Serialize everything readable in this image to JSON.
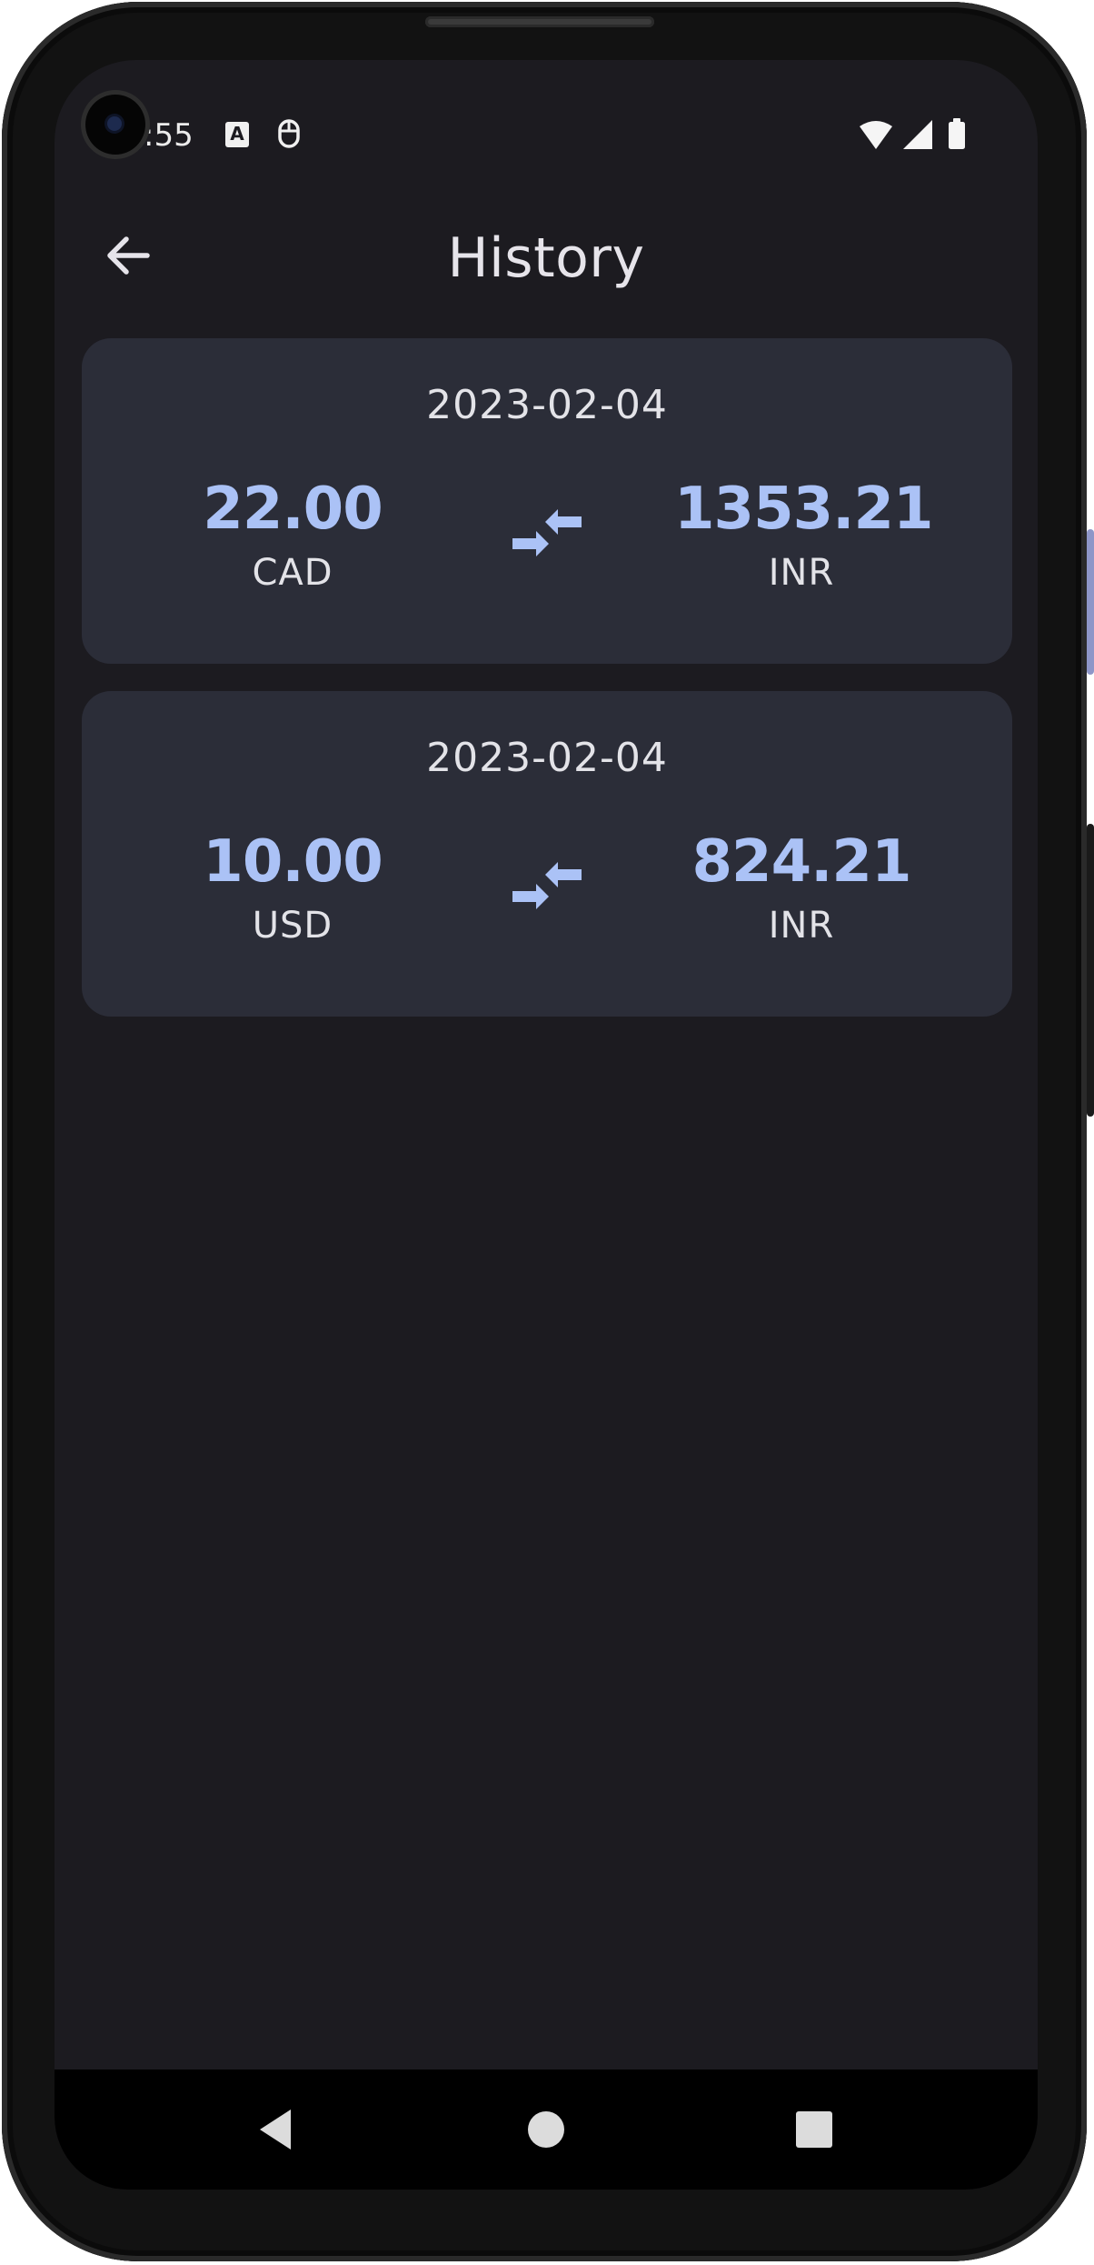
{
  "status_bar": {
    "time": ":55",
    "icons": [
      "a11y-letter-icon",
      "mouse-icon",
      "wifi-icon",
      "cellular-signal-icon",
      "battery-icon"
    ],
    "a_icon_letter": "A"
  },
  "header": {
    "title": "History",
    "back_icon": "arrow-back-icon"
  },
  "history": [
    {
      "date": "2023-02-04",
      "from_amount": "22.00",
      "from_currency": "CAD",
      "to_amount": "1353.21",
      "to_currency": "INR",
      "swap_icon": "compare-arrows-icon"
    },
    {
      "date": "2023-02-04",
      "from_amount": "10.00",
      "from_currency": "USD",
      "to_amount": "824.21",
      "to_currency": "INR",
      "swap_icon": "compare-arrows-icon"
    }
  ],
  "nav_bar": {
    "icons": [
      "nav-back-triangle-icon",
      "nav-home-circle-icon",
      "nav-recents-square-icon"
    ]
  },
  "colors": {
    "background": "#1c1b20",
    "card": "#2b2d38",
    "accent": "#abc2f6",
    "text": "#e3e3e8"
  }
}
